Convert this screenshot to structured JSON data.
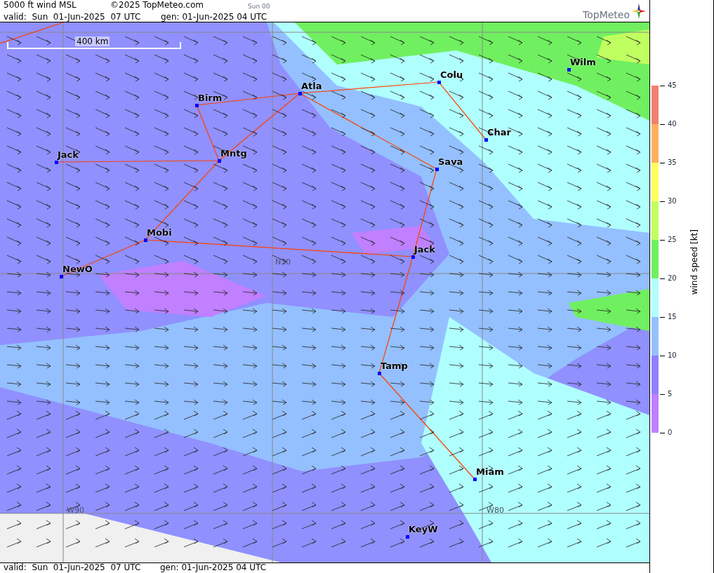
{
  "header": {
    "title": "5000 ft wind MSL",
    "copyright": "©2025 TopMeteo.com",
    "run": "Sun 00",
    "valid": "valid:  Sun  01-Jun-2025  07 UTC",
    "generated": "gen: 01-Jun-2025 04 UTC",
    "logo": "TopMeteo"
  },
  "map": {
    "scale": "400 km",
    "cities": [
      "Birm",
      "Atla",
      "Colu",
      "Wilm",
      "Char",
      "Jack",
      "Mntg",
      "Sava",
      "Mobi",
      "Jack",
      "NewO",
      "Tamp",
      "Miam",
      "KeyW"
    ],
    "grid_labels": [
      "N30",
      "W90",
      "W80"
    ]
  },
  "legend": {
    "title": "wind speed [kt]",
    "ticks": [
      "45",
      "40",
      "35",
      "30",
      "25",
      "20",
      "15",
      "10",
      "5",
      "0"
    ],
    "bands": [
      {
        "color": "#f08070"
      },
      {
        "color": "#ffb060"
      },
      {
        "color": "#ffff60"
      },
      {
        "color": "#c0ff60"
      },
      {
        "color": "#70f060"
      },
      {
        "color": "#b0ffff"
      },
      {
        "color": "#94c0ff"
      },
      {
        "color": "#9080ff"
      },
      {
        "color": "#c080ff"
      }
    ]
  },
  "footer": {
    "valid": "valid:  Sun  01-Jun-2025  07 UTC",
    "generated": "gen: 01-Jun-2025 04 UTC"
  }
}
